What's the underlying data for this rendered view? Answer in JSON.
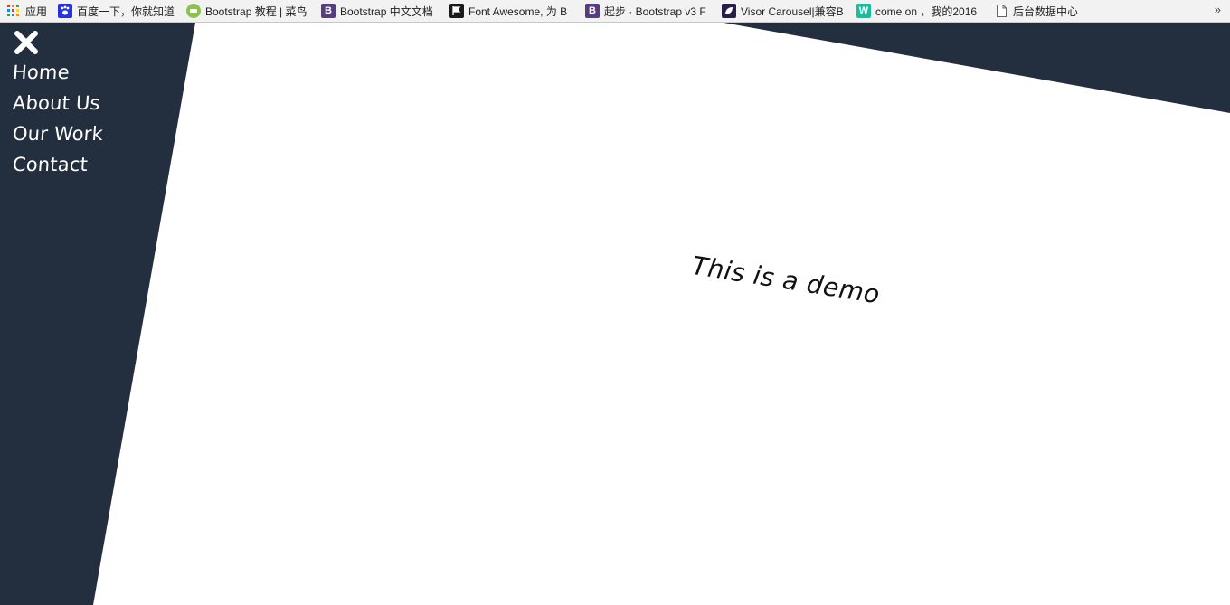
{
  "bookmarks": [
    {
      "icon": "apps-grid-icon",
      "label": "应用"
    },
    {
      "icon": "baidu-paw-icon",
      "label": "百度一下，你就知道"
    },
    {
      "icon": "runoob-icon",
      "label": "Bootstrap 教程 | 菜鸟"
    },
    {
      "icon": "bootstrap-icon",
      "icon_text": "B",
      "label": "Bootstrap 中文文档"
    },
    {
      "icon": "flag-icon",
      "label": "Font Awesome, 为 B"
    },
    {
      "icon": "bootstrap-icon",
      "icon_text": "B",
      "label": "起步 · Bootstrap v3 F"
    },
    {
      "icon": "leaf-icon",
      "label": "Visor Carousel|兼容B"
    },
    {
      "icon": "w-icon",
      "icon_text": "W",
      "label": "come on ，我的2016"
    },
    {
      "icon": "page-icon",
      "label": "后台数据中心"
    }
  ],
  "more_label": "»",
  "nav": {
    "items": [
      "Home",
      "About Us",
      "Our Work",
      "Contact"
    ]
  },
  "main": {
    "demo_text": "This is a demo"
  },
  "colors": {
    "panel": "#232f3f",
    "background": "#ffffff",
    "text": "#111111",
    "nav_text": "#ffffff"
  }
}
